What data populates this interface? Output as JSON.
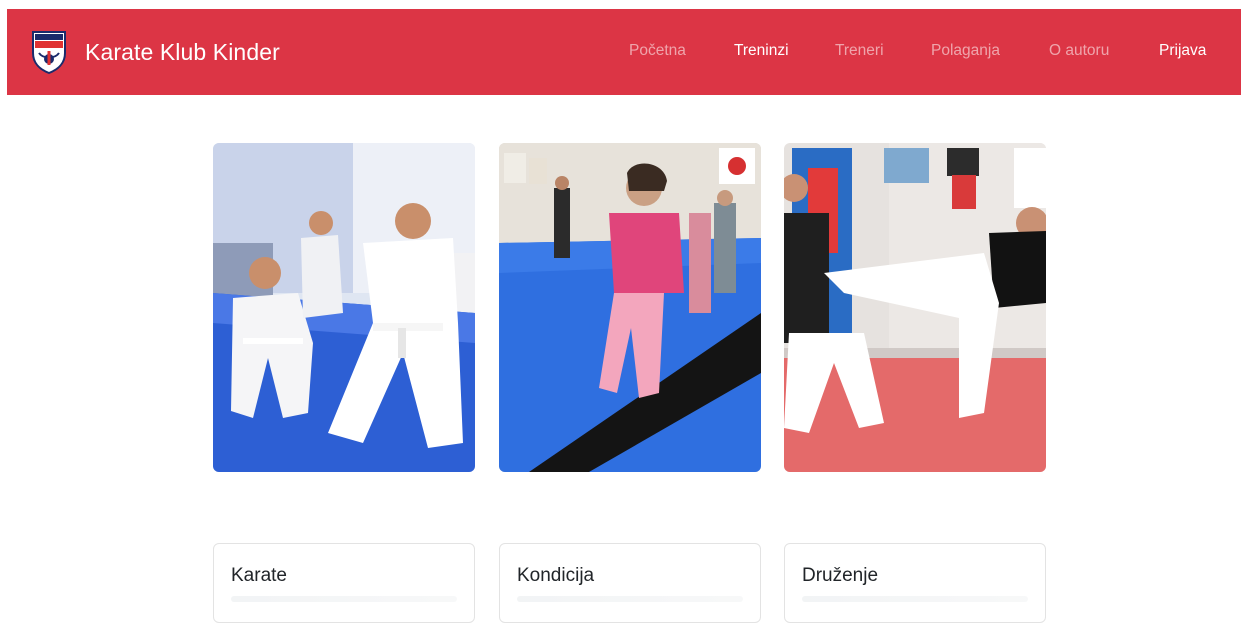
{
  "brand": {
    "name": "Karate Klub Kinder",
    "logo_text_top": "KARATE KLUB",
    "logo_text_main": "KINDER"
  },
  "nav": {
    "items": [
      {
        "label": "Početna",
        "active": false
      },
      {
        "label": "Treninzi",
        "active": true
      },
      {
        "label": "Treneri",
        "active": false
      },
      {
        "label": "Polaganja",
        "active": false
      },
      {
        "label": "O autoru",
        "active": false
      },
      {
        "label": "Prijava",
        "active": true
      }
    ]
  },
  "photos": [
    {
      "subject": "kids-in-karate-gi"
    },
    {
      "subject": "girl-balancing-on-beam"
    },
    {
      "subject": "high-kick-sparring"
    }
  ],
  "cards": [
    {
      "title": "Karate"
    },
    {
      "title": "Kondicija"
    },
    {
      "title": "Druženje"
    }
  ],
  "colors": {
    "navbar": "#dc3545",
    "nav_active": "#ffffff",
    "nav_inactive": "rgba(255,255,255,0.55)",
    "mat_blue": "#2f6fe0",
    "mat_red": "#d9605f"
  }
}
